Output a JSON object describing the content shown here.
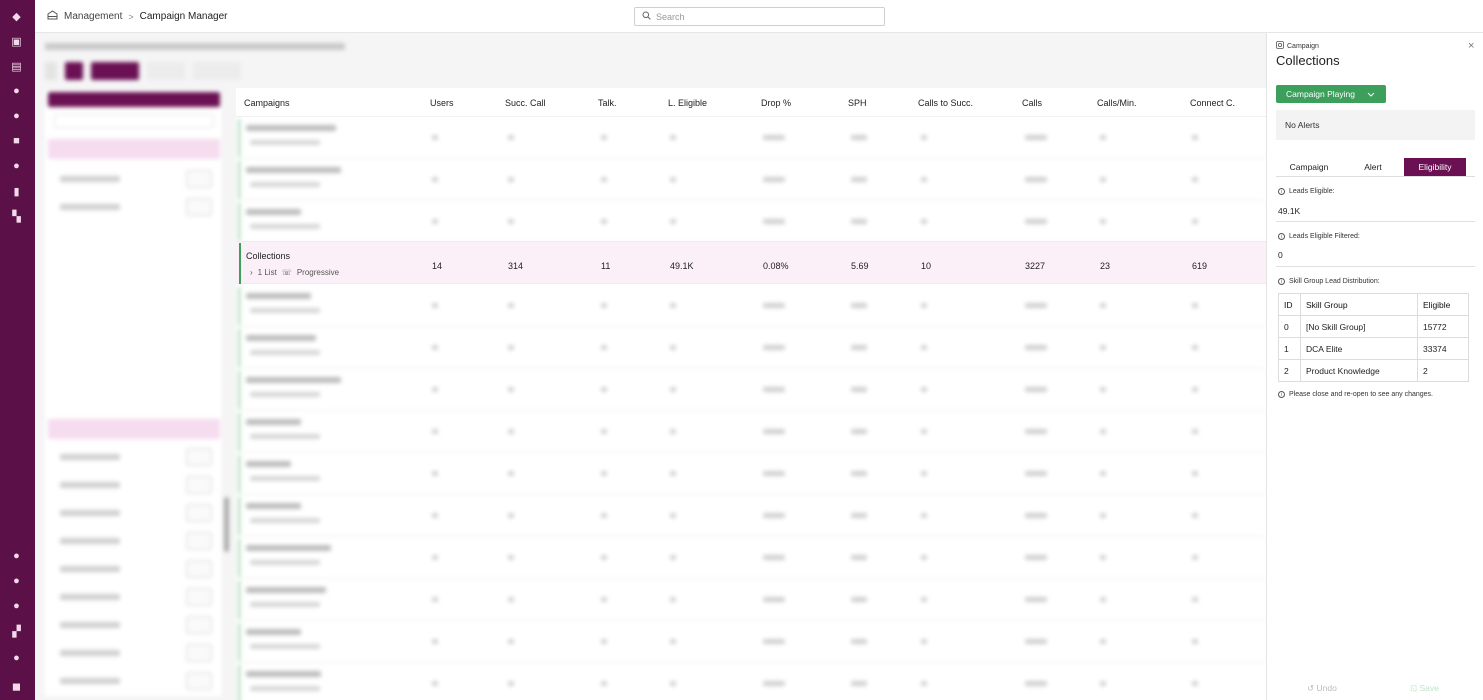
{
  "breadcrumb": {
    "root": "Management",
    "separator": ">",
    "current": "Campaign Manager"
  },
  "search": {
    "placeholder": "Search"
  },
  "table": {
    "headers": [
      "Campaigns",
      "Users",
      "Succ. Call",
      "Talk.",
      "L. Eligible",
      "Drop %",
      "SPH",
      "Calls to Succ.",
      "Calls",
      "Calls/Min.",
      "Connect C."
    ],
    "selected_row": {
      "name": "Collections",
      "lists": "1 List",
      "mode": "Progressive",
      "values": [
        "14",
        "314",
        "11",
        "49.1K",
        "0.08%",
        "5.69",
        "10",
        "3227",
        "23",
        "619"
      ]
    }
  },
  "drawer": {
    "kind": "Campaign",
    "title": "Collections",
    "status_label": "Campaign Playing",
    "alerts": "No Alerts",
    "tabs": [
      "Campaign",
      "Alert",
      "Eligibility"
    ],
    "active_tab": "Eligibility",
    "leads_eligible_label": "Leads Eligible:",
    "leads_eligible_value": "49.1K",
    "leads_filtered_label": "Leads Eligible Filtered:",
    "leads_filtered_value": "0",
    "skill_dist_label": "Skill Group Lead Distribution:",
    "skill_table": {
      "headers": [
        "ID",
        "Skill Group",
        "Eligible"
      ],
      "rows": [
        [
          "0",
          "[No Skill Group]",
          "15772"
        ],
        [
          "1",
          "DCA Elite",
          "33374"
        ],
        [
          "2",
          "Product Knowledge",
          "2"
        ]
      ]
    },
    "note": "Please close and re-open to see any changes.",
    "undo_label": "Undo",
    "save_label": "Save"
  },
  "colors": {
    "rail": "#5b1048",
    "accent_purple": "#6a1053",
    "playing_green": "#3c9f5b",
    "selected_row_bg": "#fbf0f8"
  },
  "icons": {
    "breadcrumb": "building-icon",
    "search": "search-icon",
    "close": "close-icon",
    "status_chevron": "chevron-down-icon",
    "info": "info-icon",
    "undo": "undo-icon",
    "save": "save-icon"
  }
}
